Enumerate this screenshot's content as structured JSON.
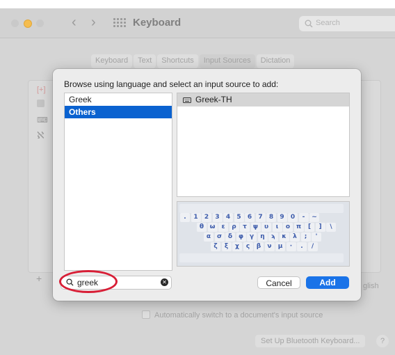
{
  "window": {
    "title": "Keyboard",
    "search_placeholder": "Search"
  },
  "tabs": [
    "Keyboard",
    "Text",
    "Shortcuts",
    "Input Sources",
    "Dictation"
  ],
  "selected_tab": "Input Sources",
  "background": {
    "auto_switch_label": "Automatically switch to a document's input source",
    "bluetooth_button": "Set Up Bluetooth Keyboard...",
    "help_label": "?",
    "partial_label": "glish",
    "add_symbol": "+"
  },
  "sheet": {
    "prompt": "Browse using language and select an input source to add:",
    "languages": [
      {
        "label": "Greek",
        "selected": false
      },
      {
        "label": "Others",
        "selected": true
      }
    ],
    "sources": [
      "Greek-TH"
    ],
    "keyboard_rows": [
      [
        ".",
        "1",
        "2",
        "3",
        "4",
        "5",
        "6",
        "7",
        "8",
        "9",
        "0",
        "-",
        "~"
      ],
      [
        "θ",
        "ω",
        "ε",
        "ρ",
        "τ",
        "ψ",
        "υ",
        "ι",
        "ο",
        "π",
        "[",
        "]",
        "\\"
      ],
      [
        "α",
        "σ",
        "δ",
        "φ",
        "γ",
        "η",
        "ϡ",
        "κ",
        "λ",
        ";",
        "'"
      ],
      [
        "ζ",
        "ξ",
        "χ",
        "ς",
        "β",
        "ν",
        "μ",
        "·",
        ".",
        "/"
      ]
    ],
    "search_value": "greek",
    "cancel_label": "Cancel",
    "add_label": "Add"
  },
  "colors": {
    "accent": "#1a73e8",
    "selection": "#0a62d0",
    "annotation": "#d81e36",
    "key_text": "#3d5cab"
  }
}
